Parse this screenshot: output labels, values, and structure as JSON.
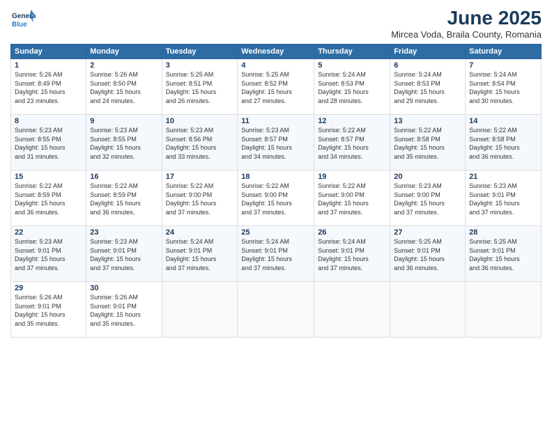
{
  "header": {
    "logo_line1": "General",
    "logo_line2": "Blue",
    "title": "June 2025",
    "subtitle": "Mircea Voda, Braila County, Romania"
  },
  "days_of_week": [
    "Sunday",
    "Monday",
    "Tuesday",
    "Wednesday",
    "Thursday",
    "Friday",
    "Saturday"
  ],
  "weeks": [
    [
      {
        "day": "1",
        "detail": "Sunrise: 5:26 AM\nSunset: 8:49 PM\nDaylight: 15 hours\nand 23 minutes."
      },
      {
        "day": "2",
        "detail": "Sunrise: 5:26 AM\nSunset: 8:50 PM\nDaylight: 15 hours\nand 24 minutes."
      },
      {
        "day": "3",
        "detail": "Sunrise: 5:25 AM\nSunset: 8:51 PM\nDaylight: 15 hours\nand 26 minutes."
      },
      {
        "day": "4",
        "detail": "Sunrise: 5:25 AM\nSunset: 8:52 PM\nDaylight: 15 hours\nand 27 minutes."
      },
      {
        "day": "5",
        "detail": "Sunrise: 5:24 AM\nSunset: 8:53 PM\nDaylight: 15 hours\nand 28 minutes."
      },
      {
        "day": "6",
        "detail": "Sunrise: 5:24 AM\nSunset: 8:53 PM\nDaylight: 15 hours\nand 29 minutes."
      },
      {
        "day": "7",
        "detail": "Sunrise: 5:24 AM\nSunset: 8:54 PM\nDaylight: 15 hours\nand 30 minutes."
      }
    ],
    [
      {
        "day": "8",
        "detail": "Sunrise: 5:23 AM\nSunset: 8:55 PM\nDaylight: 15 hours\nand 31 minutes."
      },
      {
        "day": "9",
        "detail": "Sunrise: 5:23 AM\nSunset: 8:55 PM\nDaylight: 15 hours\nand 32 minutes."
      },
      {
        "day": "10",
        "detail": "Sunrise: 5:23 AM\nSunset: 8:56 PM\nDaylight: 15 hours\nand 33 minutes."
      },
      {
        "day": "11",
        "detail": "Sunrise: 5:23 AM\nSunset: 8:57 PM\nDaylight: 15 hours\nand 34 minutes."
      },
      {
        "day": "12",
        "detail": "Sunrise: 5:22 AM\nSunset: 8:57 PM\nDaylight: 15 hours\nand 34 minutes."
      },
      {
        "day": "13",
        "detail": "Sunrise: 5:22 AM\nSunset: 8:58 PM\nDaylight: 15 hours\nand 35 minutes."
      },
      {
        "day": "14",
        "detail": "Sunrise: 5:22 AM\nSunset: 8:58 PM\nDaylight: 15 hours\nand 36 minutes."
      }
    ],
    [
      {
        "day": "15",
        "detail": "Sunrise: 5:22 AM\nSunset: 8:59 PM\nDaylight: 15 hours\nand 36 minutes."
      },
      {
        "day": "16",
        "detail": "Sunrise: 5:22 AM\nSunset: 8:59 PM\nDaylight: 15 hours\nand 36 minutes."
      },
      {
        "day": "17",
        "detail": "Sunrise: 5:22 AM\nSunset: 9:00 PM\nDaylight: 15 hours\nand 37 minutes."
      },
      {
        "day": "18",
        "detail": "Sunrise: 5:22 AM\nSunset: 9:00 PM\nDaylight: 15 hours\nand 37 minutes."
      },
      {
        "day": "19",
        "detail": "Sunrise: 5:22 AM\nSunset: 9:00 PM\nDaylight: 15 hours\nand 37 minutes."
      },
      {
        "day": "20",
        "detail": "Sunrise: 5:23 AM\nSunset: 9:00 PM\nDaylight: 15 hours\nand 37 minutes."
      },
      {
        "day": "21",
        "detail": "Sunrise: 5:23 AM\nSunset: 9:01 PM\nDaylight: 15 hours\nand 37 minutes."
      }
    ],
    [
      {
        "day": "22",
        "detail": "Sunrise: 5:23 AM\nSunset: 9:01 PM\nDaylight: 15 hours\nand 37 minutes."
      },
      {
        "day": "23",
        "detail": "Sunrise: 5:23 AM\nSunset: 9:01 PM\nDaylight: 15 hours\nand 37 minutes."
      },
      {
        "day": "24",
        "detail": "Sunrise: 5:24 AM\nSunset: 9:01 PM\nDaylight: 15 hours\nand 37 minutes."
      },
      {
        "day": "25",
        "detail": "Sunrise: 5:24 AM\nSunset: 9:01 PM\nDaylight: 15 hours\nand 37 minutes."
      },
      {
        "day": "26",
        "detail": "Sunrise: 5:24 AM\nSunset: 9:01 PM\nDaylight: 15 hours\nand 37 minutes."
      },
      {
        "day": "27",
        "detail": "Sunrise: 5:25 AM\nSunset: 9:01 PM\nDaylight: 15 hours\nand 36 minutes."
      },
      {
        "day": "28",
        "detail": "Sunrise: 5:25 AM\nSunset: 9:01 PM\nDaylight: 15 hours\nand 36 minutes."
      }
    ],
    [
      {
        "day": "29",
        "detail": "Sunrise: 5:26 AM\nSunset: 9:01 PM\nDaylight: 15 hours\nand 35 minutes."
      },
      {
        "day": "30",
        "detail": "Sunrise: 5:26 AM\nSunset: 9:01 PM\nDaylight: 15 hours\nand 35 minutes."
      },
      {
        "day": "",
        "detail": ""
      },
      {
        "day": "",
        "detail": ""
      },
      {
        "day": "",
        "detail": ""
      },
      {
        "day": "",
        "detail": ""
      },
      {
        "day": "",
        "detail": ""
      }
    ]
  ]
}
